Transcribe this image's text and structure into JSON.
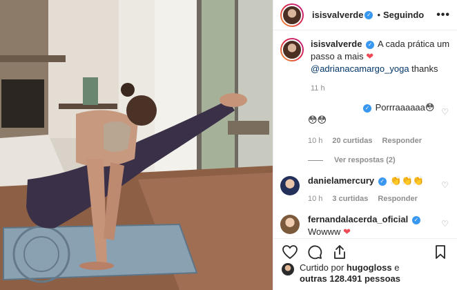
{
  "post": {
    "author": "isisvalverde",
    "follow_status": "Seguindo",
    "separator": "•",
    "more_label": "•••"
  },
  "caption": {
    "username": "isisvalverde",
    "text": "A cada prática um passo a mais",
    "heart": "❤",
    "mention": "@adrianacamargo_yoga",
    "suffix": " thanks",
    "time": "11 h"
  },
  "comments": [
    {
      "username": "",
      "text": "Porrraaaaaa😳",
      "second_line": "😳😳",
      "time": "10 h",
      "likes": "20 curtidas",
      "reply_label": "Responder",
      "view_replies": "Ver respostas (2)"
    },
    {
      "username": "danielamercury",
      "text": "👏👏👏",
      "time": "10 h",
      "likes": "3 curtidas",
      "reply_label": "Responder"
    },
    {
      "username": "fernandalacerda_oficial",
      "text": "Wowww",
      "heart": "❤"
    }
  ],
  "icons": {
    "verified": "✓",
    "like_small": "♡"
  },
  "likes_summary": {
    "prefix": "Curtido por ",
    "user": "hugogloss",
    "middle": " e",
    "others": "outras 128.491 pessoas"
  },
  "colors": {
    "accent": "#3897f0",
    "heart": "#ed4956",
    "mention": "#003569",
    "muted": "#8e8e8e"
  }
}
